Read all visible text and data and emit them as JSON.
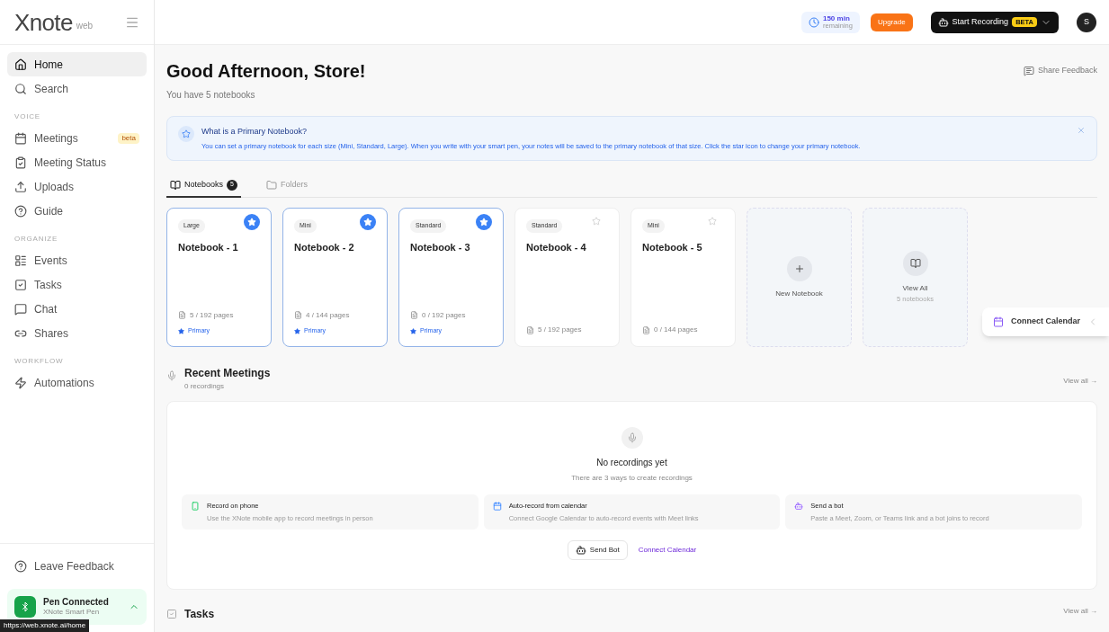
{
  "brand": {
    "name": "Xnote",
    "suffix": "web"
  },
  "sidebar": {
    "sections": [
      {
        "items": [
          {
            "label": "Home",
            "selected": true
          },
          {
            "label": "Search",
            "selected": false
          }
        ]
      },
      {
        "heading": "VOICE",
        "items": [
          {
            "label": "Meetings",
            "selected": false,
            "badge": "beta"
          },
          {
            "label": "Meeting Status",
            "selected": false
          },
          {
            "label": "Uploads",
            "selected": false
          },
          {
            "label": "Guide",
            "selected": false
          }
        ]
      },
      {
        "heading": "ORGANIZE",
        "items": [
          {
            "label": "Events",
            "selected": false
          },
          {
            "label": "Tasks",
            "selected": false
          },
          {
            "label": "Chat",
            "selected": false
          },
          {
            "label": "Shares",
            "selected": false
          }
        ]
      },
      {
        "heading": "WORKFLOW",
        "items": [
          {
            "label": "Automations",
            "selected": false
          }
        ]
      }
    ],
    "feedback": "Leave Feedback",
    "pen": {
      "title": "Pen Connected",
      "subtitle": "XNote Smart Pen"
    }
  },
  "status_url": "https://web.xnote.ai/home",
  "topbar": {
    "minutes": "150 min",
    "minutes_caption": "remaining",
    "upgrade": "Upgrade",
    "record": "Start Recording",
    "record_badge": "BETA",
    "avatar": "S"
  },
  "header": {
    "title": "Good Afternoon, Store!",
    "subtitle": "You have 5 notebooks",
    "share_feedback": "Share Feedback"
  },
  "banner": {
    "title": "What is a Primary Notebook?",
    "text": "You can set a primary notebook for each size (Mini, Standard, Large). When you write with your smart pen, your notes will be saved to the primary notebook of that size. Click the star icon to change your primary notebook."
  },
  "tabs": [
    {
      "label": "Notebooks",
      "count": "5",
      "selected": true
    },
    {
      "label": "Folders",
      "selected": false
    }
  ],
  "notebooks": [
    {
      "size": "Large",
      "title": "Notebook - 1",
      "pages": "5 / 192 pages",
      "primary": true,
      "primary_label": "Primary"
    },
    {
      "size": "Mini",
      "title": "Notebook - 2",
      "pages": "4 / 144 pages",
      "primary": true,
      "primary_label": "Primary"
    },
    {
      "size": "Standard",
      "title": "Notebook - 3",
      "pages": "0 / 192 pages",
      "primary": true,
      "primary_label": "Primary"
    },
    {
      "size": "Standard",
      "title": "Notebook - 4",
      "pages": "5 / 192 pages",
      "primary": false
    },
    {
      "size": "Mini",
      "title": "Notebook - 5",
      "pages": "0 / 144 pages",
      "primary": false
    }
  ],
  "new_notebook": "New Notebook",
  "view_all_card": {
    "title": "View All",
    "caption": "5 notebooks"
  },
  "connect_calendar_tab": "Connect Calendar",
  "recent_meetings": {
    "title": "Recent Meetings",
    "subtitle": "0 recordings",
    "view_all": "View all →",
    "empty_title": "No recordings yet",
    "empty_text": "There are 3 ways to create recordings",
    "ways": [
      {
        "kind": "phone",
        "title": "Record on phone",
        "text": "Use the XNote mobile app to record meetings in person"
      },
      {
        "kind": "calendar",
        "title": "Auto-record from calendar",
        "text": "Connect Google Calendar to auto-record events with Meet links"
      },
      {
        "kind": "bot",
        "title": "Send a bot",
        "text": "Paste a Meet, Zoom, or Teams link and a bot joins to record"
      }
    ],
    "send_bot": "Send Bot",
    "connect_calendar": "Connect Calendar"
  },
  "tasks": {
    "title": "Tasks",
    "view_all": "View all →"
  }
}
